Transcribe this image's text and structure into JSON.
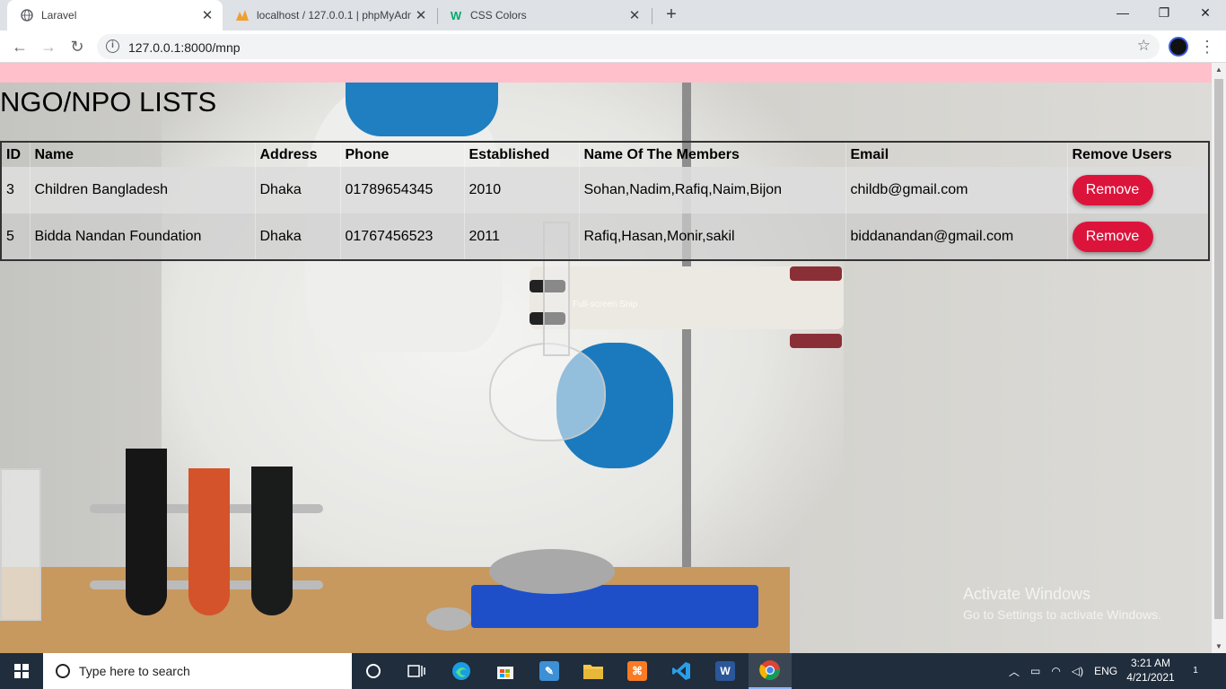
{
  "browser": {
    "tabs": [
      {
        "title": "Laravel",
        "active": true
      },
      {
        "title": "localhost / 127.0.0.1 | phpMyAdmin",
        "active": false
      },
      {
        "title": "CSS Colors",
        "active": false
      }
    ],
    "url": "127.0.0.1:8000/mnp"
  },
  "page": {
    "title": "NGO/NPO LISTS",
    "accent_color": "#ffc0cb",
    "button_color": "#dc143c",
    "table": {
      "columns": [
        "ID",
        "Name",
        "Address",
        "Phone",
        "Established",
        "Name Of The Members",
        "Email",
        "Remove Users"
      ],
      "rows": [
        {
          "id": "3",
          "name": "Children Bangladesh",
          "address": "Dhaka",
          "phone": "01789654345",
          "established": "2010",
          "members": "Sohan,Nadim,Rafiq,Naim,Bijon",
          "email": "childb@gmail.com",
          "action": "Remove"
        },
        {
          "id": "5",
          "name": "Bidda Nandan Foundation",
          "address": "Dhaka",
          "phone": "01767456523",
          "established": "2011",
          "members": "Rafiq,Hasan,Monir,sakil",
          "email": "biddanandan@gmail.com",
          "action": "Remove"
        }
      ]
    },
    "snip_hint": "Full-screen Snip",
    "watermark": {
      "line1": "Activate Windows",
      "line2": "Go to Settings to activate Windows."
    }
  },
  "taskbar": {
    "search_placeholder": "Type here to search",
    "tray_lang": "ENG",
    "time": "3:21 AM",
    "date": "4/21/2021",
    "notification_count": "1"
  }
}
